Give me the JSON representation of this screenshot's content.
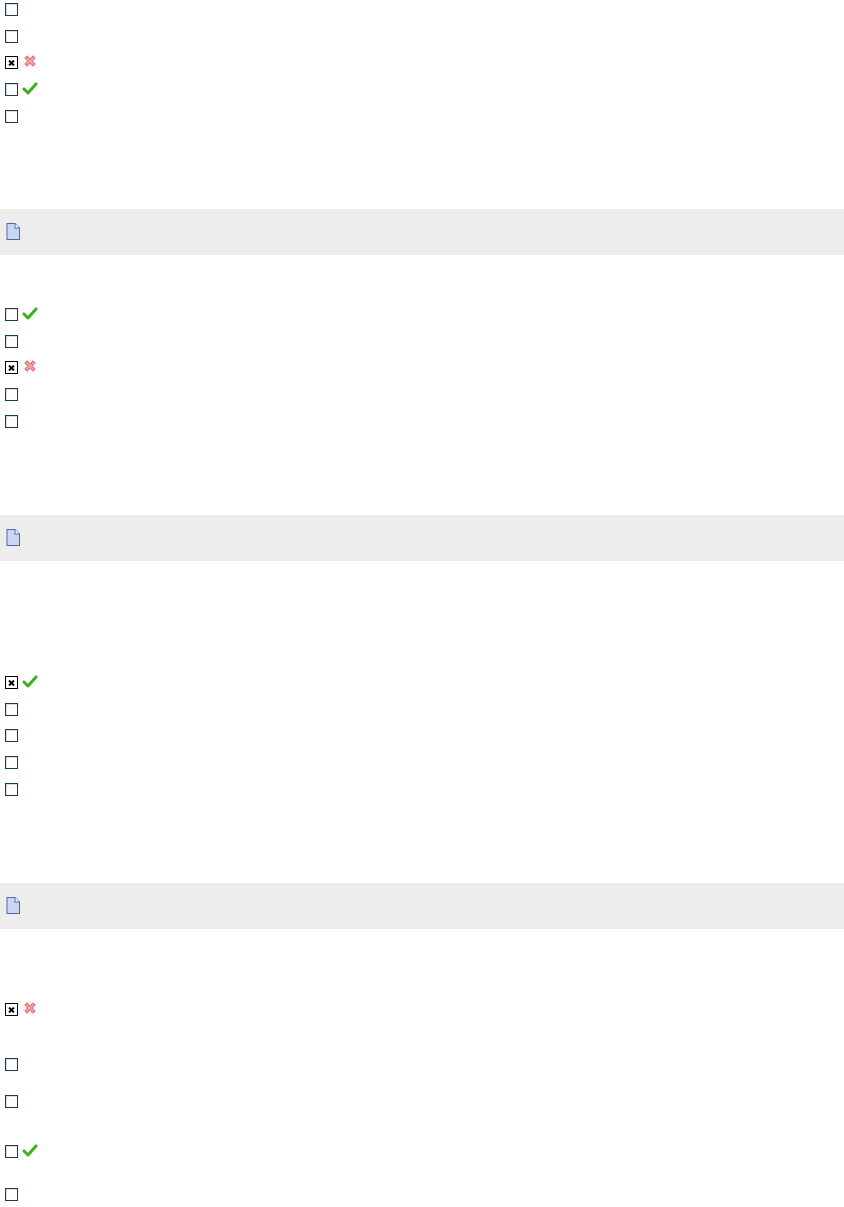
{
  "groups": [
    {
      "options": [
        {
          "checked": false,
          "feedback": "none"
        },
        {
          "checked": false,
          "feedback": "none"
        },
        {
          "checked": true,
          "feedback": "incorrect"
        },
        {
          "checked": false,
          "feedback": "correct"
        },
        {
          "checked": false,
          "feedback": "none"
        }
      ],
      "feedback_text": ""
    },
    {
      "options": [
        {
          "checked": false,
          "feedback": "correct"
        },
        {
          "checked": false,
          "feedback": "none"
        },
        {
          "checked": true,
          "feedback": "incorrect"
        },
        {
          "checked": false,
          "feedback": "none"
        },
        {
          "checked": false,
          "feedback": "none"
        }
      ],
      "feedback_text": ""
    },
    {
      "options": [
        {
          "checked": true,
          "feedback": "correct"
        },
        {
          "checked": false,
          "feedback": "none"
        },
        {
          "checked": false,
          "feedback": "none"
        },
        {
          "checked": false,
          "feedback": "none"
        },
        {
          "checked": false,
          "feedback": "none"
        }
      ],
      "feedback_text": ""
    },
    {
      "options": [
        {
          "checked": true,
          "feedback": "incorrect"
        },
        {
          "checked": false,
          "feedback": "none"
        },
        {
          "checked": false,
          "feedback": "none"
        },
        {
          "checked": false,
          "feedback": "correct"
        },
        {
          "checked": false,
          "feedback": "none"
        }
      ],
      "feedback_text": ""
    }
  ],
  "icons": {
    "correct": "green-check-icon",
    "incorrect": "red-cross-icon",
    "feedback": "document-icon"
  },
  "colors": {
    "correct": "#3fae1c",
    "incorrect": "#e8737a",
    "feedback_background": "#ededed",
    "document_fill": "#c9d7f2"
  }
}
